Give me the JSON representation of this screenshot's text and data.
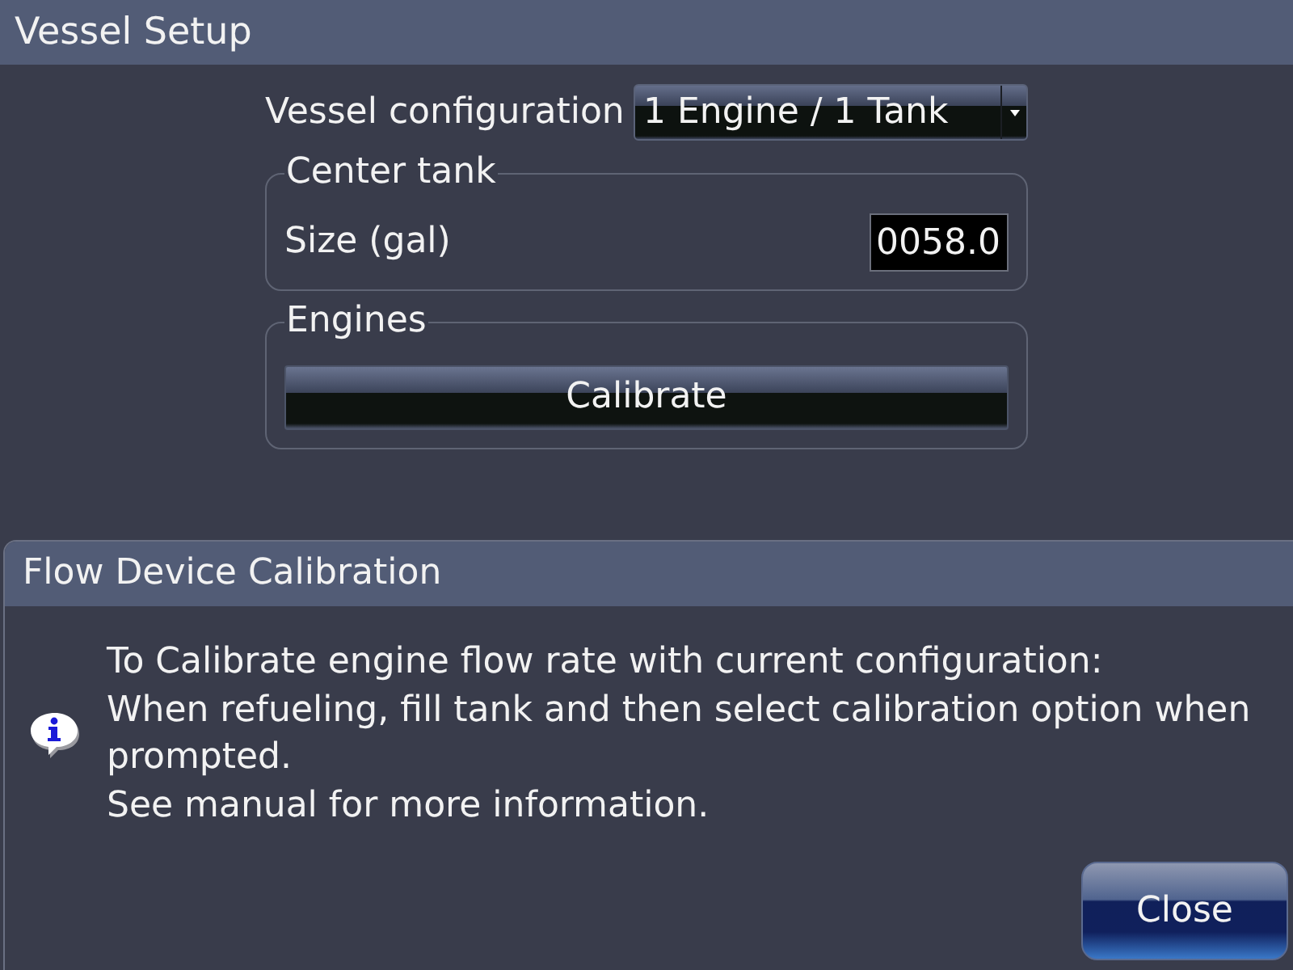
{
  "window": {
    "title": "Vessel Setup"
  },
  "vessel_configuration": {
    "label": "Vessel configuration",
    "value": "1 Engine / 1 Tank"
  },
  "center_tank": {
    "title": "Center tank",
    "size": {
      "label": "Size (gal)",
      "value": "0058.0"
    }
  },
  "engines": {
    "title": "Engines",
    "button": "Calibrate"
  },
  "dialog": {
    "title": "Flow Device Calibration",
    "kind": "info",
    "lines": [
      "To Calibrate engine flow rate with current configuration:",
      "When refueling, fill tank and then select calibration option when prompted.",
      "See manual for more information."
    ],
    "button": "Close"
  }
}
